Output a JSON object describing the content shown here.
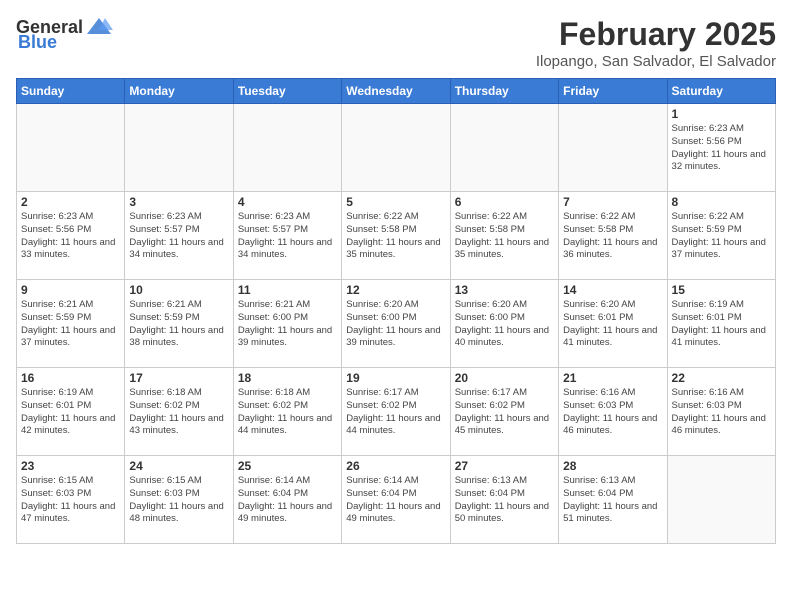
{
  "header": {
    "logo_general": "General",
    "logo_blue": "Blue",
    "month_year": "February 2025",
    "location": "Ilopango, San Salvador, El Salvador"
  },
  "days_of_week": [
    "Sunday",
    "Monday",
    "Tuesday",
    "Wednesday",
    "Thursday",
    "Friday",
    "Saturday"
  ],
  "weeks": [
    [
      {
        "day": "",
        "info": ""
      },
      {
        "day": "",
        "info": ""
      },
      {
        "day": "",
        "info": ""
      },
      {
        "day": "",
        "info": ""
      },
      {
        "day": "",
        "info": ""
      },
      {
        "day": "",
        "info": ""
      },
      {
        "day": "1",
        "info": "Sunrise: 6:23 AM\nSunset: 5:56 PM\nDaylight: 11 hours and 32 minutes."
      }
    ],
    [
      {
        "day": "2",
        "info": "Sunrise: 6:23 AM\nSunset: 5:56 PM\nDaylight: 11 hours and 33 minutes."
      },
      {
        "day": "3",
        "info": "Sunrise: 6:23 AM\nSunset: 5:57 PM\nDaylight: 11 hours and 34 minutes."
      },
      {
        "day": "4",
        "info": "Sunrise: 6:23 AM\nSunset: 5:57 PM\nDaylight: 11 hours and 34 minutes."
      },
      {
        "day": "5",
        "info": "Sunrise: 6:22 AM\nSunset: 5:58 PM\nDaylight: 11 hours and 35 minutes."
      },
      {
        "day": "6",
        "info": "Sunrise: 6:22 AM\nSunset: 5:58 PM\nDaylight: 11 hours and 35 minutes."
      },
      {
        "day": "7",
        "info": "Sunrise: 6:22 AM\nSunset: 5:58 PM\nDaylight: 11 hours and 36 minutes."
      },
      {
        "day": "8",
        "info": "Sunrise: 6:22 AM\nSunset: 5:59 PM\nDaylight: 11 hours and 37 minutes."
      }
    ],
    [
      {
        "day": "9",
        "info": "Sunrise: 6:21 AM\nSunset: 5:59 PM\nDaylight: 11 hours and 37 minutes."
      },
      {
        "day": "10",
        "info": "Sunrise: 6:21 AM\nSunset: 5:59 PM\nDaylight: 11 hours and 38 minutes."
      },
      {
        "day": "11",
        "info": "Sunrise: 6:21 AM\nSunset: 6:00 PM\nDaylight: 11 hours and 39 minutes."
      },
      {
        "day": "12",
        "info": "Sunrise: 6:20 AM\nSunset: 6:00 PM\nDaylight: 11 hours and 39 minutes."
      },
      {
        "day": "13",
        "info": "Sunrise: 6:20 AM\nSunset: 6:00 PM\nDaylight: 11 hours and 40 minutes."
      },
      {
        "day": "14",
        "info": "Sunrise: 6:20 AM\nSunset: 6:01 PM\nDaylight: 11 hours and 41 minutes."
      },
      {
        "day": "15",
        "info": "Sunrise: 6:19 AM\nSunset: 6:01 PM\nDaylight: 11 hours and 41 minutes."
      }
    ],
    [
      {
        "day": "16",
        "info": "Sunrise: 6:19 AM\nSunset: 6:01 PM\nDaylight: 11 hours and 42 minutes."
      },
      {
        "day": "17",
        "info": "Sunrise: 6:18 AM\nSunset: 6:02 PM\nDaylight: 11 hours and 43 minutes."
      },
      {
        "day": "18",
        "info": "Sunrise: 6:18 AM\nSunset: 6:02 PM\nDaylight: 11 hours and 44 minutes."
      },
      {
        "day": "19",
        "info": "Sunrise: 6:17 AM\nSunset: 6:02 PM\nDaylight: 11 hours and 44 minutes."
      },
      {
        "day": "20",
        "info": "Sunrise: 6:17 AM\nSunset: 6:02 PM\nDaylight: 11 hours and 45 minutes."
      },
      {
        "day": "21",
        "info": "Sunrise: 6:16 AM\nSunset: 6:03 PM\nDaylight: 11 hours and 46 minutes."
      },
      {
        "day": "22",
        "info": "Sunrise: 6:16 AM\nSunset: 6:03 PM\nDaylight: 11 hours and 46 minutes."
      }
    ],
    [
      {
        "day": "23",
        "info": "Sunrise: 6:15 AM\nSunset: 6:03 PM\nDaylight: 11 hours and 47 minutes."
      },
      {
        "day": "24",
        "info": "Sunrise: 6:15 AM\nSunset: 6:03 PM\nDaylight: 11 hours and 48 minutes."
      },
      {
        "day": "25",
        "info": "Sunrise: 6:14 AM\nSunset: 6:04 PM\nDaylight: 11 hours and 49 minutes."
      },
      {
        "day": "26",
        "info": "Sunrise: 6:14 AM\nSunset: 6:04 PM\nDaylight: 11 hours and 49 minutes."
      },
      {
        "day": "27",
        "info": "Sunrise: 6:13 AM\nSunset: 6:04 PM\nDaylight: 11 hours and 50 minutes."
      },
      {
        "day": "28",
        "info": "Sunrise: 6:13 AM\nSunset: 6:04 PM\nDaylight: 11 hours and 51 minutes."
      },
      {
        "day": "",
        "info": ""
      }
    ]
  ]
}
